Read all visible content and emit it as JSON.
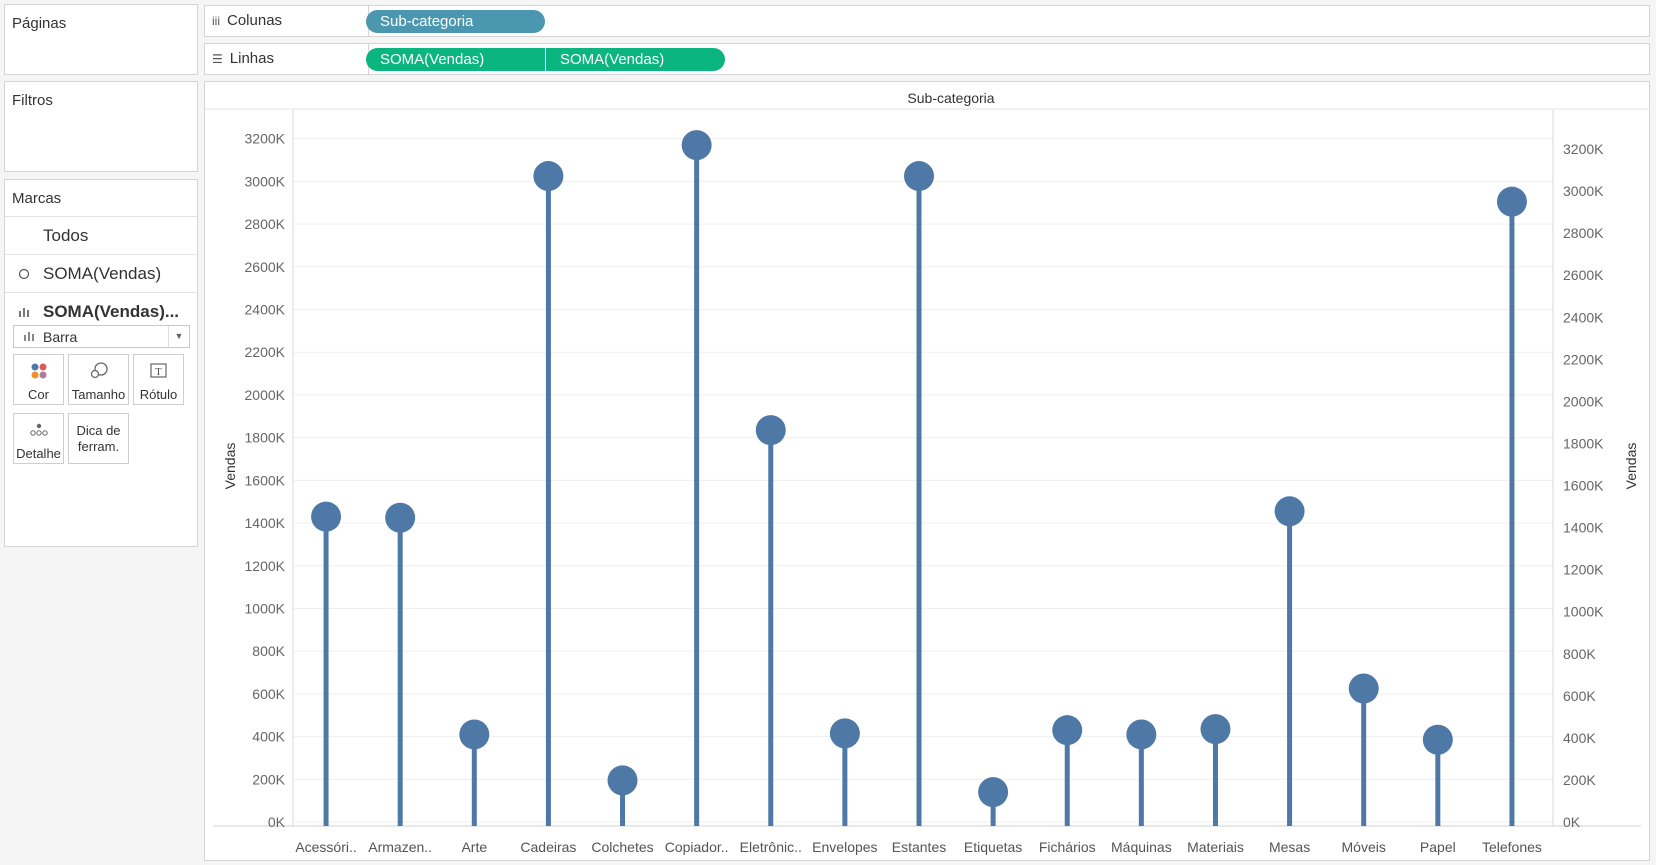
{
  "side": {
    "pages_title": "Páginas",
    "filters_title": "Filtros",
    "marks_title": "Marcas",
    "marks_cards": [
      {
        "label": "Todos",
        "icon": ""
      },
      {
        "label": "SOMA(Vendas)",
        "icon": "circle-outline-icon"
      },
      {
        "label": "SOMA(Vendas)...",
        "icon": "bar-chart-icon"
      }
    ],
    "mark_type": "Barra",
    "tiles": {
      "color": "Cor",
      "size": "Tamanho",
      "label": "Rótulo",
      "detail": "Detalhe",
      "tooltip_line1": "Dica de",
      "tooltip_line2": "ferram."
    }
  },
  "shelves": {
    "columns_label": "Colunas",
    "columns_pill": "Sub-categoria",
    "rows_label": "Linhas",
    "rows_pills": [
      "SOMA(Vendas)",
      "SOMA(Vendas)"
    ]
  },
  "colors": {
    "mark": "#4e79a7",
    "column_pill": "#4c97b0",
    "row_pill": "#0bb57f"
  },
  "chart_data": {
    "type": "bar",
    "title": "Sub-categoria",
    "ylabel": "Vendas",
    "ylabel_right": "Vendas",
    "categories": [
      "Acessóri..",
      "Armazen..",
      "Arte",
      "Cadeiras",
      "Colchetes",
      "Copiador..",
      "Eletrônic..",
      "Envelopes",
      "Estantes",
      "Etiquetas",
      "Fichários",
      "Máquinas",
      "Materiais",
      "Mesas",
      "Móveis",
      "Papel",
      "Telefones"
    ],
    "series": [
      {
        "name": "SOMA(Vendas)",
        "mark": "circle",
        "values": [
          1430000,
          1425000,
          410000,
          3025000,
          195000,
          3170000,
          1835000,
          415000,
          3025000,
          140000,
          430000,
          410000,
          435000,
          1455000,
          625000,
          385000,
          2905000
        ]
      },
      {
        "name": "SOMA(Vendas)",
        "mark": "bar",
        "values": [
          1430000,
          1425000,
          410000,
          3025000,
          195000,
          3170000,
          1835000,
          415000,
          3025000,
          140000,
          430000,
          410000,
          435000,
          1455000,
          625000,
          385000,
          2905000
        ]
      }
    ],
    "ylim": [
      0,
      3250000
    ],
    "left_ticks": [
      {
        "v": 0,
        "label": "0K"
      },
      {
        "v": 200000,
        "label": "200K"
      },
      {
        "v": 400000,
        "label": "400K"
      },
      {
        "v": 600000,
        "label": "600K"
      },
      {
        "v": 800000,
        "label": "800K"
      },
      {
        "v": 1000000,
        "label": "1000K"
      },
      {
        "v": 1200000,
        "label": "1200K"
      },
      {
        "v": 1400000,
        "label": "1400K"
      },
      {
        "v": 1600000,
        "label": "1600K"
      },
      {
        "v": 1800000,
        "label": "1800K"
      },
      {
        "v": 2000000,
        "label": "2000K"
      },
      {
        "v": 2200000,
        "label": "2200K"
      },
      {
        "v": 2400000,
        "label": "2400K"
      },
      {
        "v": 2600000,
        "label": "2600K"
      },
      {
        "v": 2800000,
        "label": "2800K"
      },
      {
        "v": 3000000,
        "label": "3000K"
      },
      {
        "v": 3200000,
        "label": "3200K"
      }
    ],
    "right_ylim": [
      0,
      3300000
    ],
    "right_ticks": [
      {
        "v": 0,
        "label": "0K"
      },
      {
        "v": 200000,
        "label": "200K"
      },
      {
        "v": 400000,
        "label": "400K"
      },
      {
        "v": 600000,
        "label": "600K"
      },
      {
        "v": 800000,
        "label": "800K"
      },
      {
        "v": 1000000,
        "label": "1000K"
      },
      {
        "v": 1200000,
        "label": "1200K"
      },
      {
        "v": 1400000,
        "label": "1400K"
      },
      {
        "v": 1600000,
        "label": "1600K"
      },
      {
        "v": 1800000,
        "label": "1800K"
      },
      {
        "v": 2000000,
        "label": "2000K"
      },
      {
        "v": 2200000,
        "label": "2200K"
      },
      {
        "v": 2400000,
        "label": "2400K"
      },
      {
        "v": 2600000,
        "label": "2600K"
      },
      {
        "v": 2800000,
        "label": "2800K"
      },
      {
        "v": 3000000,
        "label": "3000K"
      },
      {
        "v": 3200000,
        "label": "3200K"
      }
    ],
    "grid": true,
    "legend": "none"
  }
}
